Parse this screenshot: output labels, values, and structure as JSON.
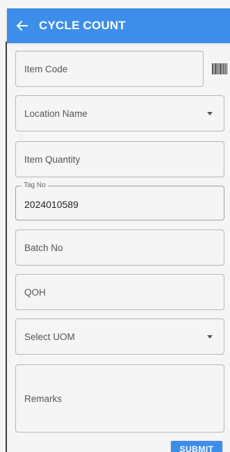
{
  "appbar": {
    "title": "CYCLE COUNT",
    "back_icon": "arrow-left-icon",
    "color": "#3d8eea"
  },
  "form": {
    "item_code_placeholder": "Item Code",
    "barcode_icon": "barcode-icon",
    "location_name_placeholder": "Location Name",
    "item_quantity_placeholder": "Item Quantity",
    "tag_no_label": "Tag No",
    "tag_no_value": "2024010589",
    "batch_no_placeholder": "Batch No",
    "qoh_placeholder": "QOH",
    "uom_placeholder": "Select UOM",
    "remarks_placeholder": "Remarks"
  },
  "actions": {
    "submit_label": "SUBMIT"
  }
}
